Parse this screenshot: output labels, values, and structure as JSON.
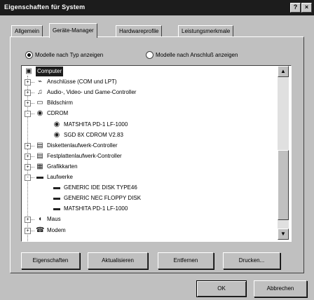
{
  "window": {
    "title": "Eigenschaften für System"
  },
  "titlebar_buttons": [
    "?",
    "×"
  ],
  "tabs": [
    {
      "label": "Allgemein",
      "active": false
    },
    {
      "label": "Geräte-Manager",
      "active": true
    },
    {
      "label": "Hardwareprofile",
      "active": false
    },
    {
      "label": "Leistungsmerkmale",
      "active": false
    }
  ],
  "view_options": {
    "by_type": "Modelle nach Typ anzeigen",
    "by_connection": "Modelle nach Anschluß anzeigen",
    "selected": "by_type"
  },
  "tree": [
    {
      "label": "Computer",
      "level": 0,
      "icon": "computer-icon",
      "expander": "-",
      "selected": true
    },
    {
      "label": "Anschlüsse (COM und LPT)",
      "level": 1,
      "icon": "port-icon",
      "expander": "+"
    },
    {
      "label": "Audio-, Video- und Game-Controller",
      "level": 1,
      "icon": "sound-icon",
      "expander": "+"
    },
    {
      "label": "Bildschirm",
      "level": 1,
      "icon": "monitor-icon",
      "expander": "+"
    },
    {
      "label": "CDROM",
      "level": 1,
      "icon": "cdrom-icon",
      "expander": "-"
    },
    {
      "label": "MATSHITA PD-1 LF-1000",
      "level": 2,
      "icon": "cdrom-device-icon"
    },
    {
      "label": "SGD 8X CDROM V2.83",
      "level": 2,
      "icon": "cdrom-device-icon"
    },
    {
      "label": "Diskettenlaufwerk-Controller",
      "level": 1,
      "icon": "controller-icon",
      "expander": "+"
    },
    {
      "label": "Festplattenlaufwerk-Controller",
      "level": 1,
      "icon": "controller-icon",
      "expander": "+"
    },
    {
      "label": "Grafikkarten",
      "level": 1,
      "icon": "display-adapter-icon",
      "expander": "+"
    },
    {
      "label": "Laufwerke",
      "level": 1,
      "icon": "drive-icon",
      "expander": "-"
    },
    {
      "label": "GENERIC IDE DISK TYPE46",
      "level": 2,
      "icon": "disk-icon"
    },
    {
      "label": "GENERIC NEC FLOPPY DISK",
      "level": 2,
      "icon": "disk-icon"
    },
    {
      "label": "MATSHITA PD-1 LF-1000",
      "level": 2,
      "icon": "disk-icon"
    },
    {
      "label": "Maus",
      "level": 1,
      "icon": "mouse-icon",
      "expander": "+"
    },
    {
      "label": "Modem",
      "level": 1,
      "icon": "modem-icon",
      "expander": "+"
    }
  ],
  "actions": {
    "properties": "Eigenschaften",
    "refresh": "Aktualisieren",
    "remove": "Entfernen",
    "print": "Drucken..."
  },
  "dialog": {
    "ok": "OK",
    "cancel": "Abbrechen"
  }
}
